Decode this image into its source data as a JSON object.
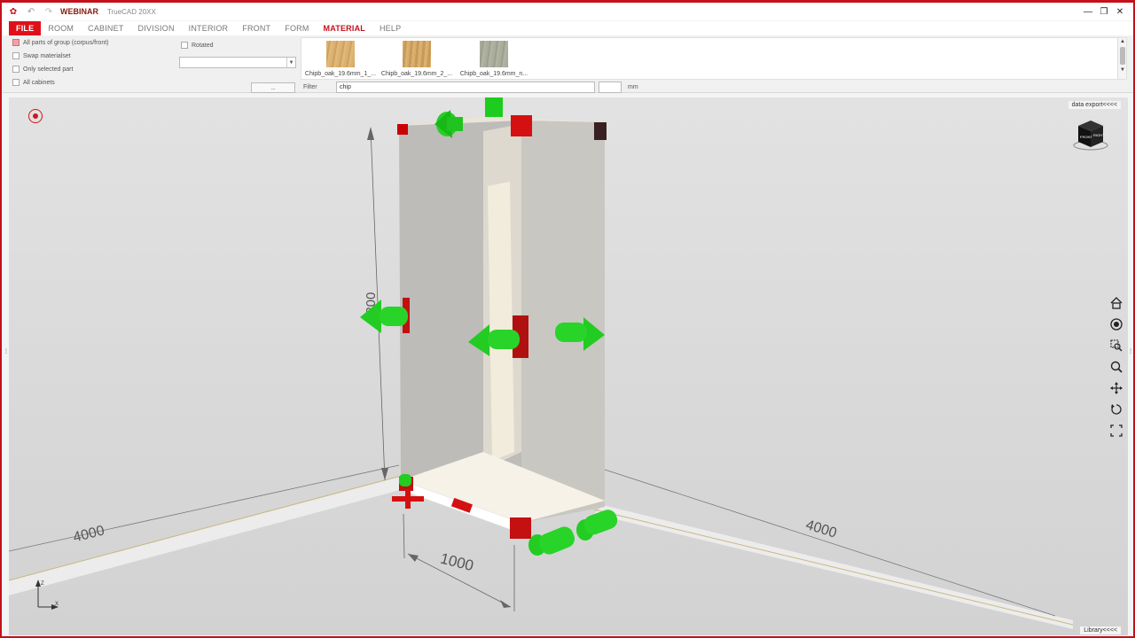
{
  "titlebar": {
    "app_name": "WEBINAR",
    "document": "TrueCAD 20XX",
    "minimize": "—",
    "restore": "❐",
    "close": "✕"
  },
  "menu": {
    "file": "FILE",
    "items": [
      "ROOM",
      "CABINET",
      "DIVISION",
      "INTERIOR",
      "FRONT",
      "FORM",
      "MATERIAL",
      "HELP"
    ],
    "active": "MATERIAL"
  },
  "options": {
    "all_parts": "All parts of group (corpus/front)",
    "swap": "Swap materialset",
    "only_selected": "Only selected part",
    "all_cabinets": "All cabinets",
    "rotated": "Rotated"
  },
  "combo": {
    "value": ""
  },
  "dots_button": "..",
  "swatches": [
    {
      "label": "Chipb_oak_19.6mm_1_...",
      "color": "#d9ad6c"
    },
    {
      "label": "Chipb_oak_19.6mm_2_...",
      "color": "#d4a868"
    },
    {
      "label": "Chipb_oak_19.6mm_n...",
      "color": "#a7a998"
    }
  ],
  "filter": {
    "label": "Filter",
    "value": "chip",
    "unit": "mm"
  },
  "viewport": {
    "data_export": "data export<<<<",
    "library": "Library<<<<",
    "dim_height": "2200",
    "dim_width": "1000",
    "dim_left": "4000",
    "dim_right": "4000",
    "viewcube_left": "FRONT",
    "viewcube_right": "RIGHT",
    "axis_z": "Z",
    "axis_x": "X"
  },
  "colors": {
    "brand_red": "#e0101a",
    "arrow_green": "#22cc22",
    "panel_white": "#f0eee8"
  }
}
